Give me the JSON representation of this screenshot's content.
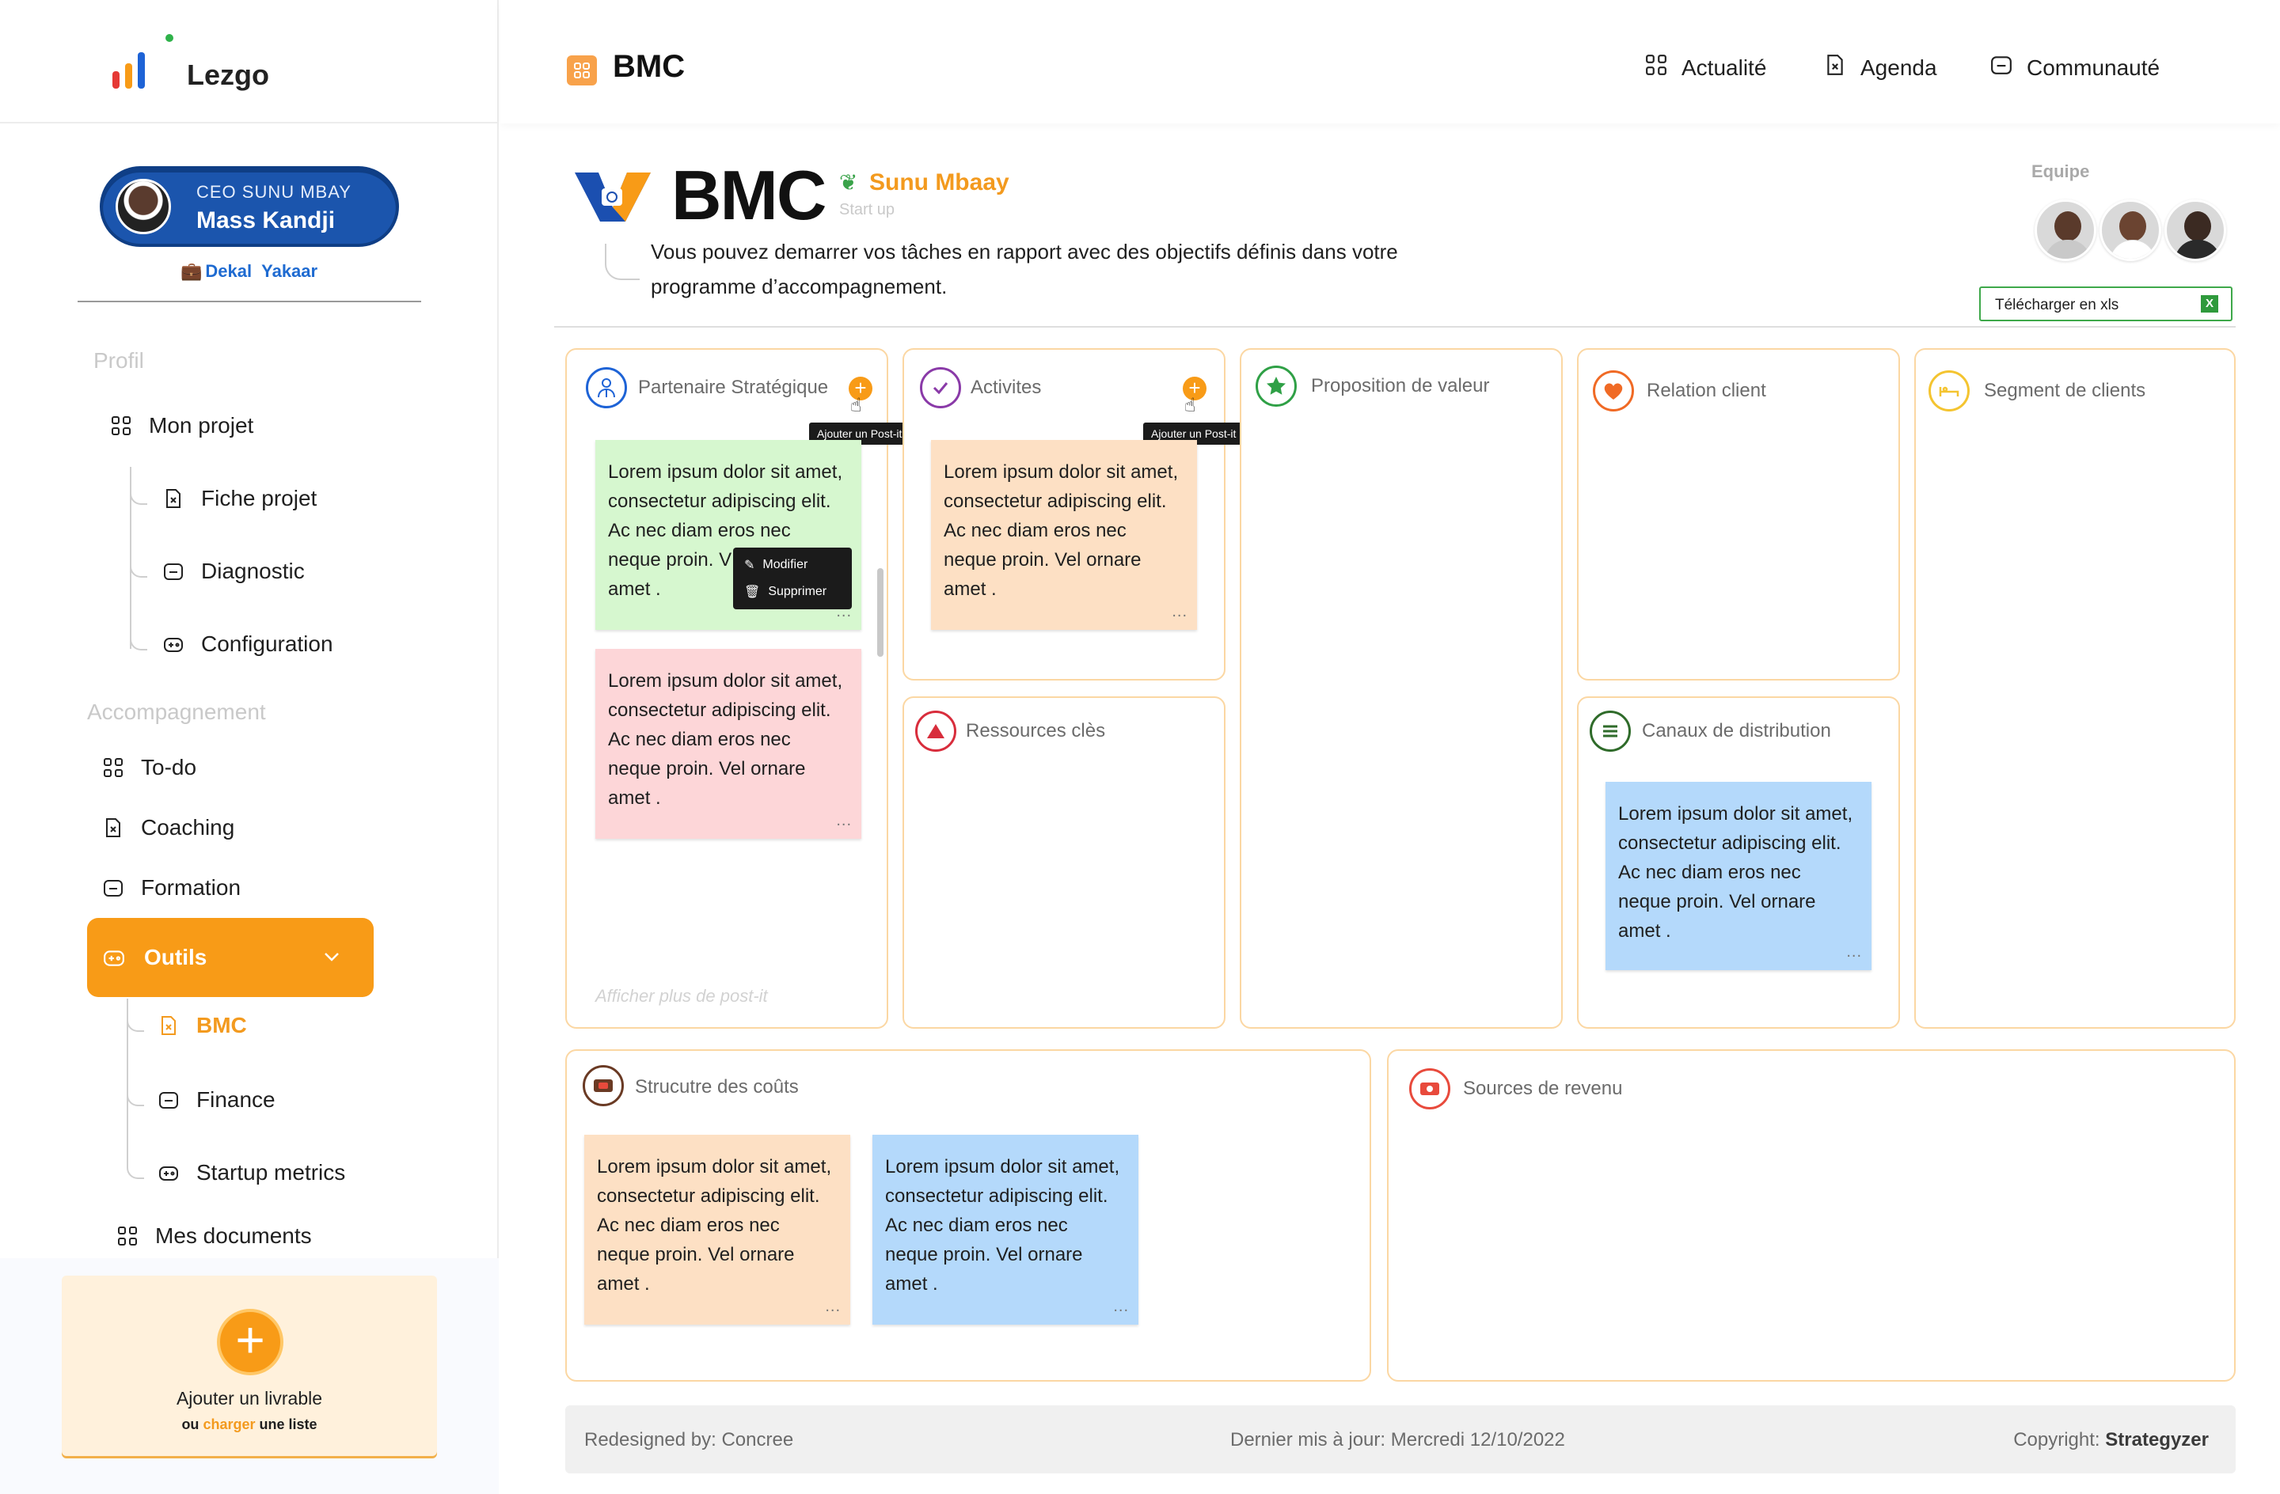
{
  "app": {
    "name": "Lezgo"
  },
  "user": {
    "role": "CEO SUNU MBAY",
    "name": "Mass Kandji",
    "company_1": "Dekal",
    "company_2": "Yakaar"
  },
  "sidebar": {
    "section_profile": "Profil",
    "mon_projet": "Mon projet",
    "fiche_projet": "Fiche projet",
    "diagnostic": "Diagnostic",
    "configuration": "Configuration",
    "section_accompagnement": "Accompagnement",
    "todo": "To-do",
    "coaching": "Coaching",
    "formation": "Formation",
    "outils": "Outils",
    "bmc": "BMC",
    "finance": "Finance",
    "startup_metrics": "Startup metrics",
    "mes_documents": "Mes documents"
  },
  "add_card": {
    "title": "Ajouter un livrable",
    "sub_1": "ou",
    "sub_2": "charger",
    "sub_3": "une liste"
  },
  "topbar": {
    "title": "BMC",
    "nav": [
      "Actualité",
      "Agenda",
      "Communauté"
    ]
  },
  "header": {
    "big_title": "BMC",
    "startup_name": "Sunu Mbaay",
    "startup_type": "Start up",
    "description": "Vous pouvez demarrer vos tâches en rapport avec des objectifs définis dans votre programme d’accompagnement.",
    "team_label": "Equipe",
    "download_label": "Télécharger en xls",
    "download_icon": "X"
  },
  "tooltip_add": "Ajouter un Post-it",
  "context_menu": {
    "edit": "Modifier",
    "delete": "Supprimer"
  },
  "note_text": "Lorem ipsum dolor sit amet, consectetur adipiscing elit. Ac nec diam eros nec neque proin. Vel ornare amet .",
  "note_text_partial": "Lorem ipsum dolor sit amet, consectetur adipiscing elit. Ac nec diam eros nec neque proin. V",
  "note_text_end": "amet .",
  "note_dots": "...",
  "blocks": {
    "partenaire": "Partenaire Stratégique",
    "activites": "Activites",
    "proposition": "Proposition de valeur",
    "relation": "Relation client",
    "segment": "Segment de clients",
    "ressources": "Ressources clès",
    "canaux": "Canaux de distribution",
    "couts": "Strucutre des coûts",
    "revenus": "Sources de revenu"
  },
  "show_more": "Afficher plus de post-it",
  "footer": {
    "left": "Redesigned by: Concree",
    "center": "Dernier mis à jour: Mercredi 12/10/2022",
    "right_label": "Copyright:",
    "right_brand": "Strategyzer"
  },
  "colors": {
    "accent": "#f89b17",
    "brand_blue": "#1b55ad",
    "green_note": "#d6f7cf",
    "orange_note": "#fde0c4",
    "pink_note": "#fdd6d8",
    "blue_note": "#b4d9fb"
  }
}
